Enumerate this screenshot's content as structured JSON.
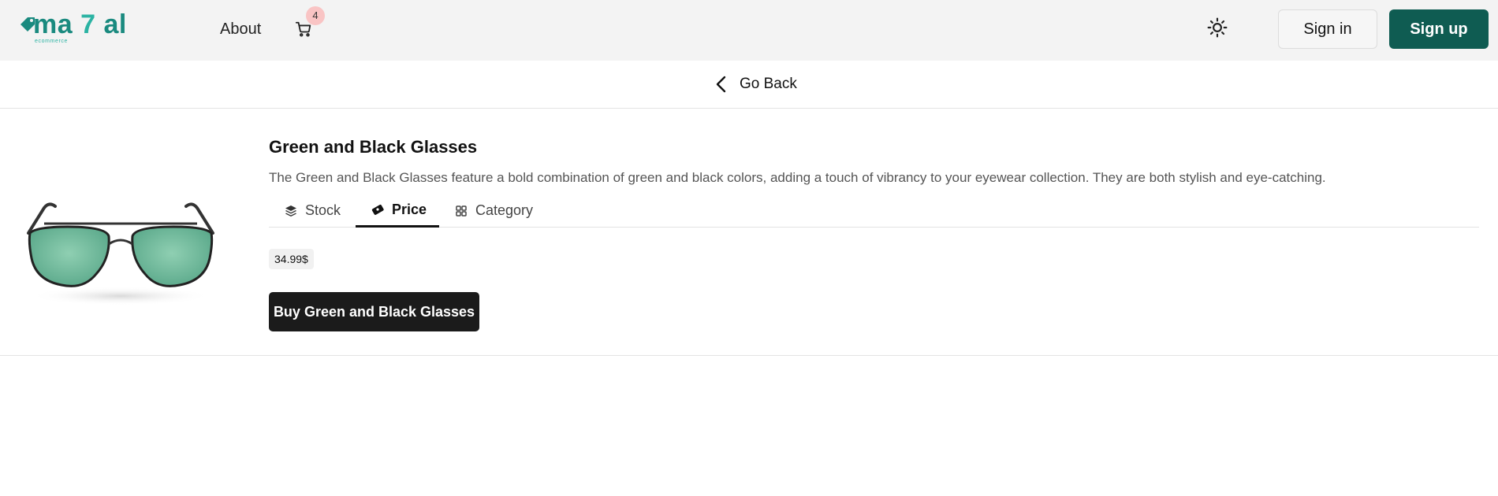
{
  "header": {
    "logo": {
      "text_left": "ma ",
      "text_seven": "7",
      "text_right": " al",
      "subtitle": "ecommerce",
      "brand_color": "#1a8a7f",
      "accent_color": "#2bb3a3"
    },
    "nav": {
      "about_label": "About"
    },
    "cart": {
      "icon": "cart-icon",
      "count": "4",
      "badge_color": "#f9c4c4"
    },
    "theme_toggle": {
      "icon": "sun-icon"
    },
    "signin_label": "Sign in",
    "signup_label": "Sign up",
    "signup_color": "#0f5c52"
  },
  "goback": {
    "label": "Go Back",
    "icon": "chevron-left-icon"
  },
  "product": {
    "title": "Green and Black Glasses",
    "description": "The Green and Black Glasses feature a bold combination of green and black colors, adding a touch of vibrancy to your eyewear collection. They are both stylish and eye-catching.",
    "tabs": [
      {
        "label": "Stock",
        "icon": "layers-icon",
        "active": false
      },
      {
        "label": "Price",
        "icon": "banknote-icon",
        "active": true
      },
      {
        "label": "Category",
        "icon": "grid-icon",
        "active": false
      }
    ],
    "price": "34.99$",
    "buy_label": "Buy Green and Black Glasses"
  }
}
